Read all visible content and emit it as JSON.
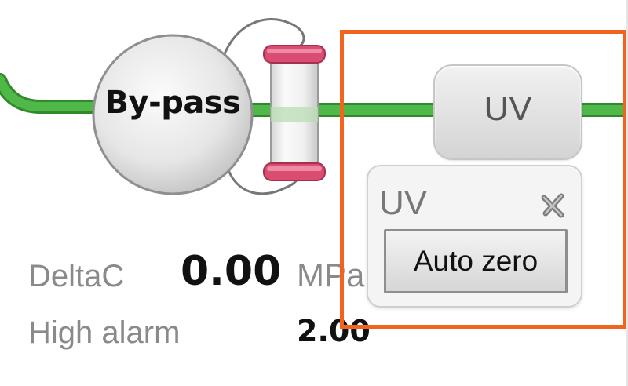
{
  "flow_diagram": {
    "valve_label": "By-pass",
    "detector_label": "UV"
  },
  "uv_popup": {
    "title": "UV",
    "close_icon": "close-x-icon",
    "auto_zero_label": "Auto zero"
  },
  "readouts": {
    "deltac_label": "DeltaC",
    "deltac_value": "0.00",
    "deltac_unit": "MPa",
    "high_alarm_label": "High alarm",
    "high_alarm_value": "2.00"
  },
  "colors": {
    "flow_line": "#3fa63a",
    "highlight": "#f2631e",
    "column_cap": "#d94d73"
  }
}
